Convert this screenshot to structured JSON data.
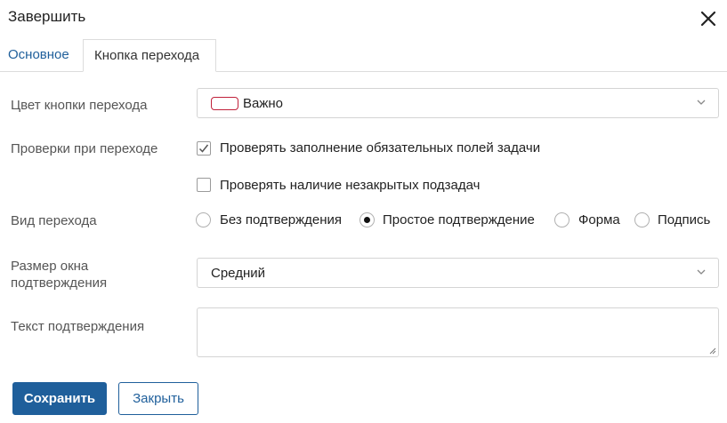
{
  "dialog": {
    "title": "Завершить"
  },
  "tabs": [
    {
      "label": "Основное",
      "active": false
    },
    {
      "label": "Кнопка перехода",
      "active": true
    }
  ],
  "form": {
    "button_color": {
      "label": "Цвет кнопки перехода",
      "value": "Важно",
      "swatch_color": "#c0213a"
    },
    "checks": {
      "label": "Проверки при переходе",
      "options": [
        {
          "label": "Проверять заполнение обязательных полей задачи",
          "checked": true
        },
        {
          "label": "Проверять наличие незакрытых подзадач",
          "checked": false
        }
      ]
    },
    "transition_type": {
      "label": "Вид перехода",
      "options": [
        {
          "label": "Без подтверждения",
          "selected": false
        },
        {
          "label": "Простое подтверждение",
          "selected": true
        },
        {
          "label": "Форма",
          "selected": false
        },
        {
          "label": "Подпись",
          "selected": false
        }
      ]
    },
    "window_size": {
      "label": "Размер окна подтверждения",
      "value": "Средний"
    },
    "confirm_text": {
      "label": "Текст подтверждения",
      "value": ""
    }
  },
  "footer": {
    "save_label": "Сохранить",
    "close_label": "Закрыть"
  },
  "colors": {
    "accent": "#1f5f9b",
    "border": "#d4d4d4"
  }
}
